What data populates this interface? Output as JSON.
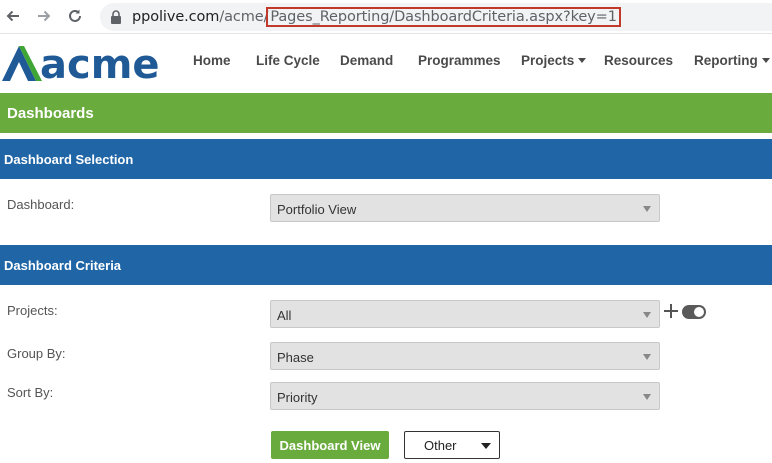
{
  "browser": {
    "url_host": "ppolive.com",
    "url_path_prefix": "/acme/",
    "url_path_highlight": "Pages_Reporting/DashboardCriteria.aspx?key=1",
    "icons": {
      "back": "arrow-left-icon",
      "forward": "arrow-right-icon",
      "reload": "reload-icon",
      "lock": "lock-icon"
    }
  },
  "header": {
    "logo_text": "acme",
    "logo_colors": {
      "dark": "#1f5a96",
      "light": "#3fa535"
    },
    "menu": [
      {
        "label": "Home",
        "has_dropdown": false
      },
      {
        "label": "Life Cycle",
        "has_dropdown": false
      },
      {
        "label": "Demand",
        "has_dropdown": false
      },
      {
        "label": "Programmes",
        "has_dropdown": false
      },
      {
        "label": "Projects",
        "has_dropdown": true
      },
      {
        "label": "Resources",
        "has_dropdown": false
      },
      {
        "label": "Reporting",
        "has_dropdown": true
      }
    ]
  },
  "page": {
    "title": "Dashboards",
    "section_selection": "Dashboard Selection",
    "section_criteria": "Dashboard Criteria"
  },
  "form": {
    "dashboard_label": "Dashboard:",
    "dashboard_value": "Portfolio View",
    "projects_label": "Projects:",
    "projects_value": "All",
    "group_by_label": "Group By:",
    "group_by_value": "Phase",
    "sort_by_label": "Sort By:",
    "sort_by_value": "Priority"
  },
  "actions": {
    "dashboard_view_label": "Dashboard View",
    "other_label": "Other"
  },
  "colors": {
    "green": "#6aab3e",
    "blue": "#2066a7",
    "highlight_border": "#c0392b"
  }
}
